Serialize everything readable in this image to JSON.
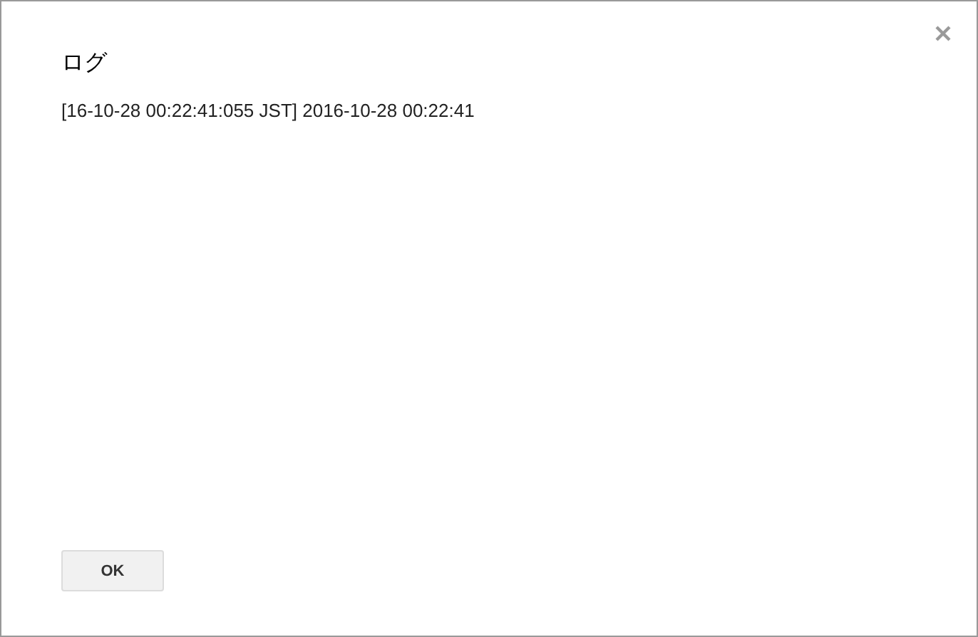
{
  "dialog": {
    "title": "ログ",
    "log_lines": [
      "[16-10-28 00:22:41:055 JST] 2016-10-28 00:22:41"
    ],
    "buttons": [
      "OK"
    ]
  }
}
